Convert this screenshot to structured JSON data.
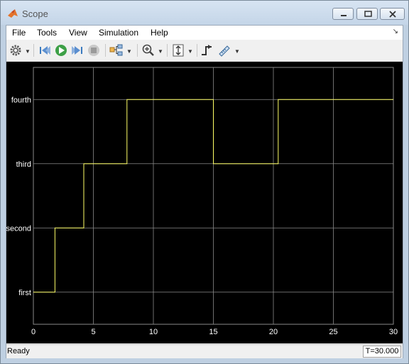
{
  "window": {
    "title": "Scope"
  },
  "menu": {
    "items": [
      "File",
      "Tools",
      "View",
      "Simulation",
      "Help"
    ]
  },
  "toolbar": {
    "icons": [
      "settings-icon",
      "step-back-icon",
      "run-icon",
      "step-forward-icon",
      "stop-icon",
      "highlight-signal-icon",
      "zoom-in-icon",
      "scale-axes-icon",
      "triggers-icon",
      "measurements-icon"
    ]
  },
  "status": {
    "text": "Ready",
    "time": "T=30.000"
  },
  "colors": {
    "plot_background": "#000000",
    "trace": "#ffff66",
    "grid": "#8a8a8a",
    "axis_text": "#ffffff"
  },
  "chart_data": {
    "type": "line",
    "step": true,
    "title": "",
    "xlabel": "",
    "ylabel": "",
    "xlim": [
      0,
      30
    ],
    "xticks": [
      0,
      5,
      10,
      15,
      20,
      25,
      30
    ],
    "yticks": [
      "first",
      "second",
      "third",
      "fourth"
    ],
    "grid": true,
    "series": [
      {
        "x": [
          0,
          1.8,
          1.8,
          4.2,
          4.2,
          7.8,
          7.8,
          15.0,
          15.0,
          20.4,
          20.4,
          30
        ],
        "y": [
          1,
          1,
          2,
          2,
          3,
          3,
          4,
          4,
          3,
          3,
          4,
          4
        ]
      }
    ]
  }
}
